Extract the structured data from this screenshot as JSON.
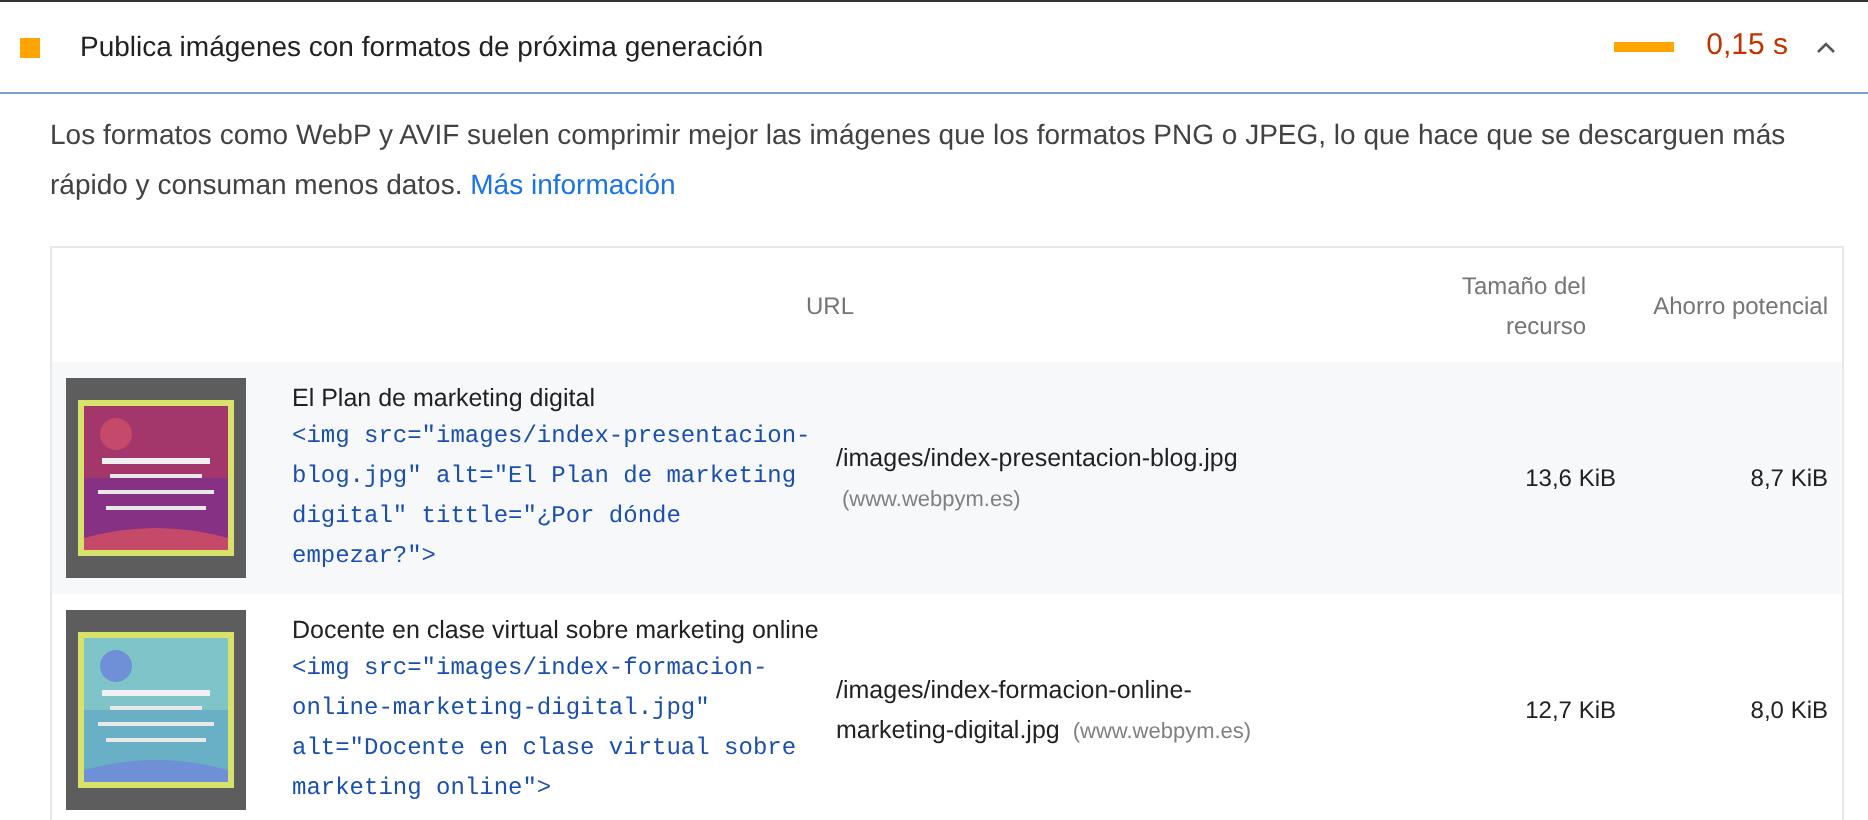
{
  "audit": {
    "title": "Publica imágenes con formatos de próxima generación",
    "savings": "0,15 s",
    "expanded": true
  },
  "description": {
    "text": "Los formatos como WebP y AVIF suelen comprimir mejor las imágenes que los formatos PNG o JPEG, lo que hace que se descarguen más rápido y consuman menos datos.",
    "link": "Más información"
  },
  "table": {
    "columns": [
      "URL",
      "Tamaño del recurso",
      "Ahorro potencial"
    ],
    "rows": [
      {
        "label": "El Plan de marketing digital",
        "snippet": "<img src=\"images/index-presentacion-blog.jpg\" alt=\"El Plan de marketing digital\" tittle=\"¿Por dónde empezar?\">",
        "url": "/images/index-presentacion-blog.jpg",
        "host": "(www.webpym.es)",
        "size": "13,6 KiB",
        "savings": "8,7 KiB"
      },
      {
        "label": "Docente en clase virtual sobre marketing online",
        "snippet": "<img src=\"images/index-formacion-online-marketing-digital.jpg\" alt=\"Docente en clase virtual sobre marketing online\">",
        "url": "/images/index-formacion-online-marketing-digital.jpg",
        "host": "(www.webpym.es)",
        "size": "12,7 KiB",
        "savings": "8,0 KiB"
      }
    ]
  }
}
